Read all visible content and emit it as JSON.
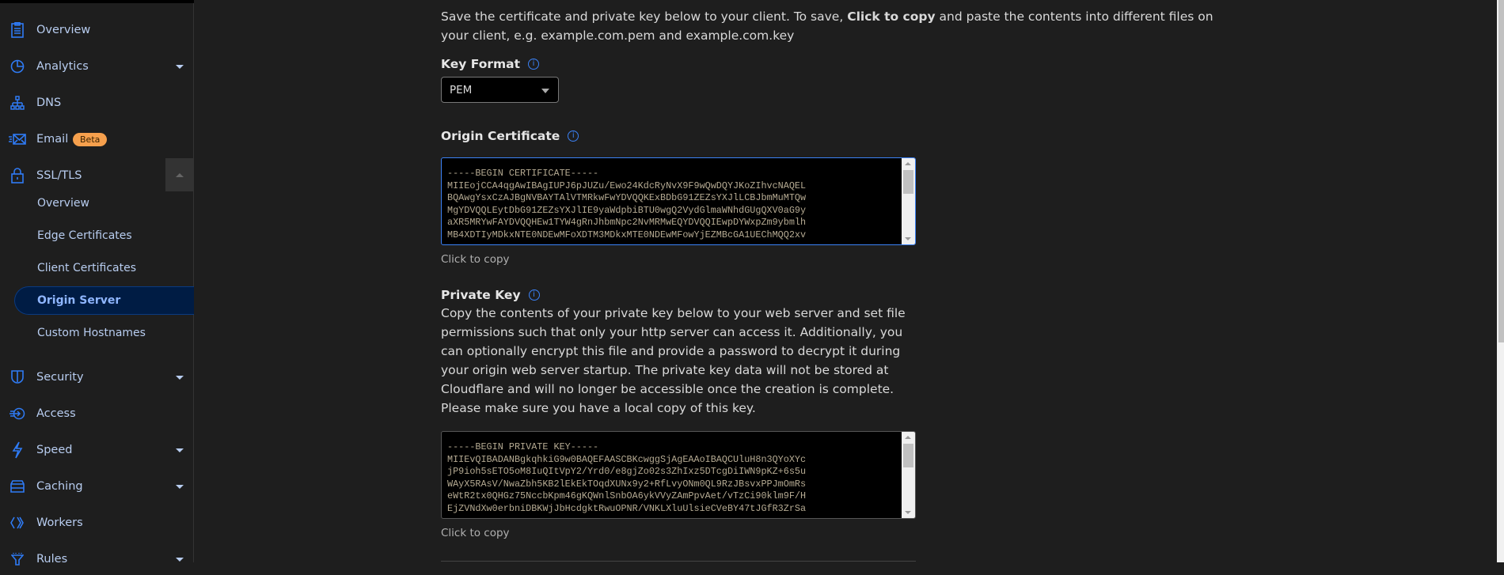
{
  "sidebar": {
    "items": [
      {
        "label": "Overview",
        "icon": "clipboard-icon"
      },
      {
        "label": "Analytics",
        "icon": "pie-chart-icon",
        "expandable": true
      },
      {
        "label": "DNS",
        "icon": "network-icon"
      },
      {
        "label": "Email",
        "icon": "email-icon",
        "badge": "Beta"
      },
      {
        "label": "SSL/TLS",
        "icon": "lock-icon",
        "expanded": true
      },
      {
        "label": "Security",
        "icon": "shield-icon",
        "expandable": true
      },
      {
        "label": "Access",
        "icon": "access-icon"
      },
      {
        "label": "Speed",
        "icon": "lightning-icon",
        "expandable": true
      },
      {
        "label": "Caching",
        "icon": "server-icon",
        "expandable": true
      },
      {
        "label": "Workers",
        "icon": "workers-icon"
      },
      {
        "label": "Rules",
        "icon": "funnel-icon",
        "expandable": true
      }
    ],
    "ssl_sub": [
      {
        "label": "Overview"
      },
      {
        "label": "Edge Certificates"
      },
      {
        "label": "Client Certificates"
      },
      {
        "label": "Origin Server",
        "active": true
      },
      {
        "label": "Custom Hostnames"
      }
    ]
  },
  "main": {
    "intro_pre": "Save the certificate and private key below to your client. To save, ",
    "intro_bold": "Click to copy",
    "intro_post": " and paste the contents into different files on your client, e.g. example.com.pem and example.com.key",
    "key_format_label": "Key Format",
    "key_format_value": "PEM",
    "origin_cert_label": "Origin Certificate",
    "origin_cert_text": "-----BEGIN CERTIFICATE-----\nMIIEojCCA4qgAwIBAgIUPJ6pJUZu/Ewo24KdcRyNvX9F9wQwDQYJKoZIhvcNAQEL\nBQAwgYsxCzAJBgNVBAYTAlVTMRkwFwYDVQQKExBDbG91ZEZsYXJlLCBJbmMuMTQw\nMgYDVQQLEytDbG91ZEZsYXJlIE9yaWdpbiBTU0wgQ2VydGlmaWNhdGUgQXV0aG9y\naXR5MRYwFAYDVQQHEw1TYW4gRnJhbmNpc2NvMRMwEQYDVQQIEwpDYWxpZm9ybmlh\nMB4XDTIyMDkxNTE0NDEwMFoXDTM3MDkxMTE0NDEwMFowYjEZMBcGA1UEChMQQ2xv",
    "click_to_copy": "Click to copy",
    "private_key_label": "Private Key",
    "private_key_desc": "Copy the contents of your private key below to your web server and set file permissions such that only your http server can access it. Additionally, you can optionally encrypt this file and provide a password to decrypt it during your origin web server startup. The private key data will not be stored at Cloudflare and will no longer be accessible once the creation is complete. Please make sure you have a local copy of this key.",
    "private_key_text": "-----BEGIN PRIVATE KEY-----\nMIIEvQIBADANBgkqhkiG9w0BAQEFAASCBKcwggSjAgEAAoIBAQCUluH8n3QYoXYc\njP9ioh5sETO5oM8IuQItVpY2/Yrd0/e8gjZo02s3ZhIxz5DTcgDiIWN9pKZ+6s5u\nWAyX5RAsV/NwaZbh5KB2lEkEkTOqdXUNx9y2+RfLvyONm0QL9RzJBsvxPPJmOmRs\neWtR2tx0QHGz75NccbKpm46gKQWnlSnbOA6ykVVyZAmPpvAet/vTzCi90klm9F/H\nEjZVNdXw0erbniDBKWjJbHcdgktRwuOPNR/VNKLXluUlsieCVeBY47tJGfR3ZrSa"
  },
  "colors": {
    "accent": "#3b82f6",
    "badge": "#f6a04d",
    "active_bg": "#001c44",
    "background": "#1e1e1e"
  }
}
